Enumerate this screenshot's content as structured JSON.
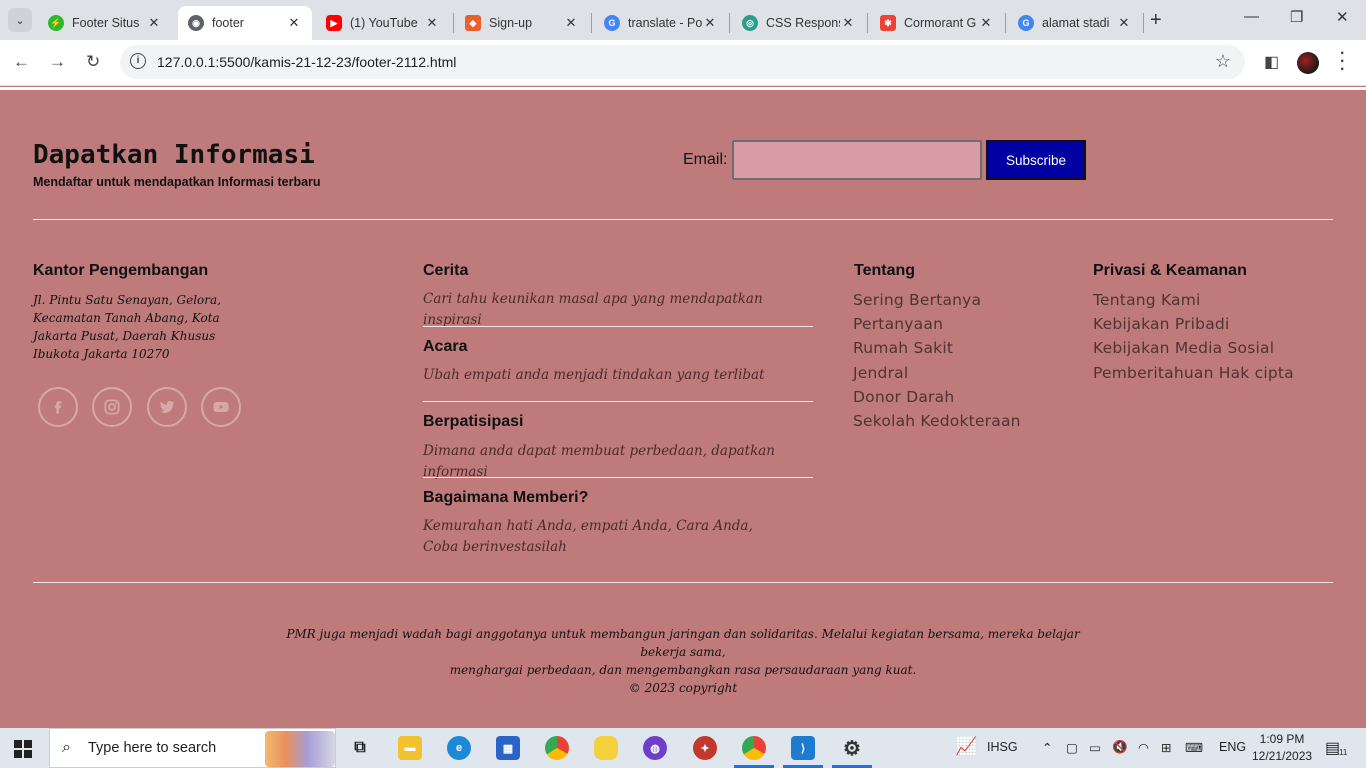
{
  "browser": {
    "tabs": [
      {
        "label": "Footer Situs",
        "favicon_color": "#2eb82e",
        "favicon": "⚡"
      },
      {
        "label": "footer",
        "favicon_color": "#5f6368",
        "favicon": "◉"
      },
      {
        "label": "(1) YouTube",
        "favicon_color": "#ff0000",
        "favicon": "▶"
      },
      {
        "label": "Sign-up",
        "favicon_color": "#e8612c",
        "favicon": "◈"
      },
      {
        "label": "translate - Po",
        "favicon_color": "#4285f4",
        "favicon": "G"
      },
      {
        "label": "CSS Respons",
        "favicon_color": "#2a9d8f",
        "favicon": "◎"
      },
      {
        "label": "Cormorant G",
        "favicon_color": "#ea4335",
        "favicon": "✱"
      },
      {
        "label": "alamat stadi",
        "favicon_color": "#4285f4",
        "favicon": "G"
      }
    ],
    "url": "127.0.0.1:5500/kamis-21-12-23/footer-2112.html"
  },
  "newsletter": {
    "title": "Dapatkan Informasi",
    "subtitle": "Mendaftar untuk mendapatkan Informasi terbaru",
    "email_label": "Email:",
    "email_value": "",
    "subscribe_label": "Subscribe"
  },
  "office": {
    "title": "Kantor Pengembangan",
    "address": "Jl. Pintu Satu Senayan, Gelora, Kecamatan Tanah Abang, Kota Jakarta Pusat, Daerah Khusus Ibukota Jakarta 10270",
    "socials": [
      "facebook-icon",
      "instagram-icon",
      "twitter-icon",
      "youtube-icon"
    ]
  },
  "stories": [
    {
      "title": "Cerita",
      "text": "Cari tahu keunikan masal apa yang mendapatkan inspirasi"
    },
    {
      "title": "Acara",
      "text": "Ubah empati anda menjadi tindakan yang terlibat"
    },
    {
      "title": "Berpatisipasi",
      "text": "Dimana anda dapat membuat perbedaan, dapatkan informasi"
    },
    {
      "title": "Bagaimana Memberi?",
      "text": "Kemurahan hati Anda, empati Anda, Cara Anda, Coba berinvestasilah"
    }
  ],
  "about": {
    "title": "Tentang",
    "links": [
      "Sering Bertanya",
      "Pertanyaan",
      "Rumah Sakit",
      "Jendral",
      "Donor Darah",
      "Sekolah Kedokteraan"
    ]
  },
  "privacy": {
    "title": "Privasi & Keamanan",
    "links": [
      "Tentang Kami",
      "Kebijakan Pribadi",
      "Kebijakan Media Sosial",
      "Pemberitahuan Hak cipta"
    ]
  },
  "footer": {
    "line1": "PMR juga menjadi wadah bagi anggotanya untuk membangun jaringan dan solidaritas. Melalui kegiatan bersama, mereka belajar bekerja sama,",
    "line2": "menghargai perbedaan, dan mengembangkan rasa persaudaraan yang kuat.",
    "copyright": "© 2023 copyright"
  },
  "taskbar": {
    "search_placeholder": "Type here to search",
    "stock_label": "IHSG",
    "language": "ENG",
    "time": "1:09 PM",
    "date": "12/21/2023",
    "notification_count": "11"
  }
}
